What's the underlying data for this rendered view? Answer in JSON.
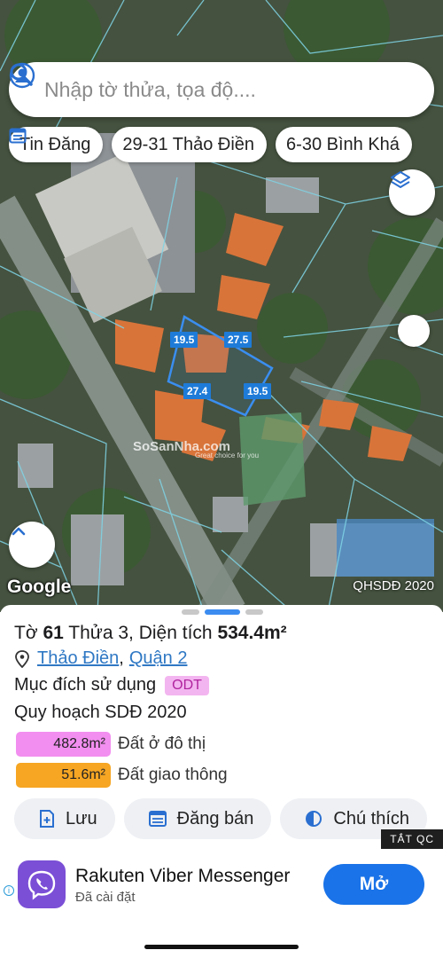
{
  "search": {
    "placeholder": "Nhập tờ thửa, tọa độ...."
  },
  "chips": [
    {
      "label": "Tin Đăng",
      "icon": "list-icon"
    },
    {
      "label": "29-31 Thảo Điền"
    },
    {
      "label": "6-30 Bình Khá"
    }
  ],
  "map": {
    "edge_labels": [
      "19.5",
      "27.5",
      "27.4",
      "19.5"
    ],
    "watermark": "SoSanNha.com",
    "watermark_tagline": "Great choice for you",
    "google_logo": "Google",
    "source_label": "QHSDĐ 2020"
  },
  "parcel": {
    "sheet_prefix": "Tờ",
    "sheet_no": "61",
    "plot_prefix": "Thửa 3, Diện tích",
    "area": "534.4m²",
    "ward": "Thảo Điền",
    "district": "Quận 2",
    "separator": ",",
    "usage_label": "Mục đích sử dụng",
    "usage_code": "ODT",
    "plan_label": "Quy hoạch SDĐ 2020",
    "zones": [
      {
        "area": "482.8m²",
        "label": "Đất ở đô thị",
        "color": "#f28ef0"
      },
      {
        "area": "51.6m²",
        "label": "Đất giao thông",
        "color": "#f6a623"
      }
    ]
  },
  "actions": [
    {
      "label": "Lưu",
      "icon": "save-add-icon"
    },
    {
      "label": "Đăng bán",
      "icon": "post-list-icon"
    },
    {
      "label": "Chú thích",
      "icon": "legend-contrast-icon"
    }
  ],
  "ad": {
    "close_label": "TẮT QC",
    "app_name": "Rakuten Viber Messenger",
    "status": "Đã cài đặt",
    "button": "Mở",
    "brand_color": "#7b4fd6"
  },
  "colors": {
    "accent": "#1a73e8",
    "parcel_outline": "#3a8ef0",
    "grid_lines": "#7fd4e6"
  }
}
